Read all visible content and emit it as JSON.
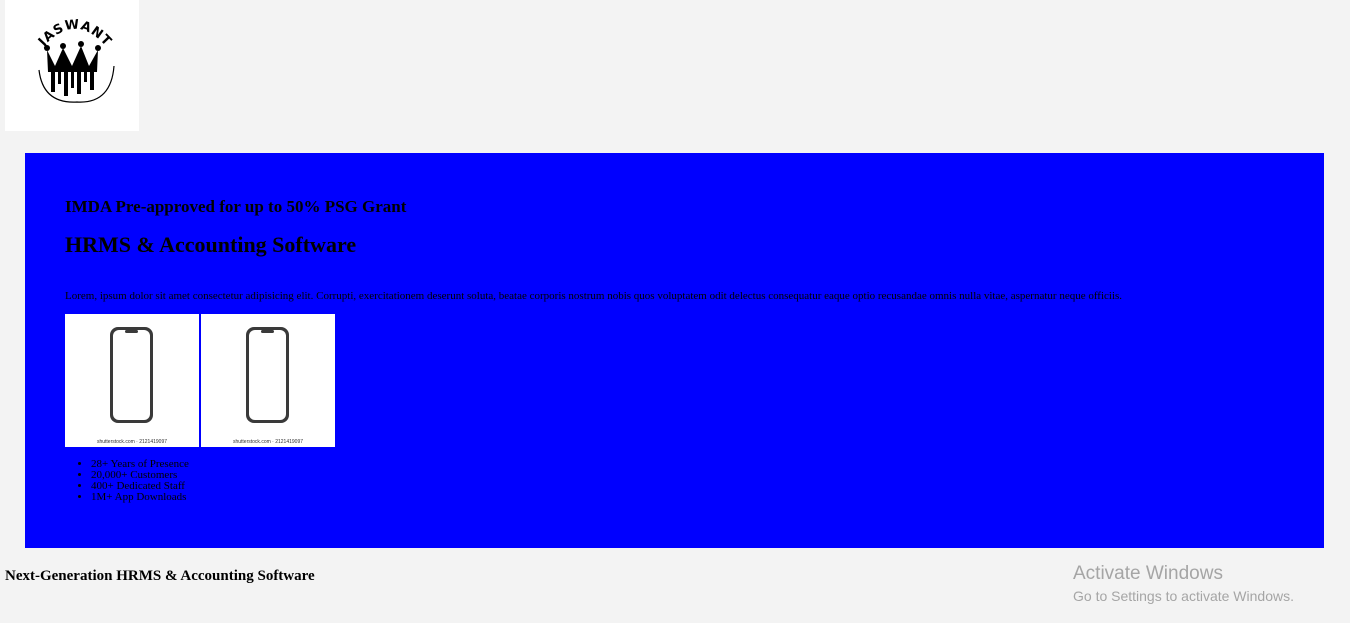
{
  "logo": {
    "brand_text": "JASWANTH",
    "icon": "crown-logo-icon"
  },
  "hero": {
    "background_color": "#0000ff",
    "grant_heading": "IMDA Pre-approved for up to 50% PSG Grant",
    "title": "HRMS & Accounting Software",
    "description": "Lorem, ipsum dolor sit amet consectetur adipisicing elit. Corrupti, exercitationem deserunt soluta, beatae corporis nostrum nobis quos voluptatem odit delectus consequatur eaque optio recusandae omnis nulla vitae, aspernatur neque officiis.",
    "phone_images": [
      {
        "icon": "smartphone-icon",
        "credit": "shutterstock.com · 2121419097"
      },
      {
        "icon": "smartphone-icon",
        "credit": "shutterstock.com · 2121419097"
      }
    ],
    "stats": [
      "28+ Years of Presence",
      "20,000+ Customers",
      "400+ Dedicated Staff",
      "1M+ App Downloads"
    ]
  },
  "section": {
    "heading": "Next-Generation HRMS & Accounting Software"
  },
  "watermark": {
    "title": "Activate Windows",
    "subtitle": "Go to Settings to activate Windows."
  }
}
